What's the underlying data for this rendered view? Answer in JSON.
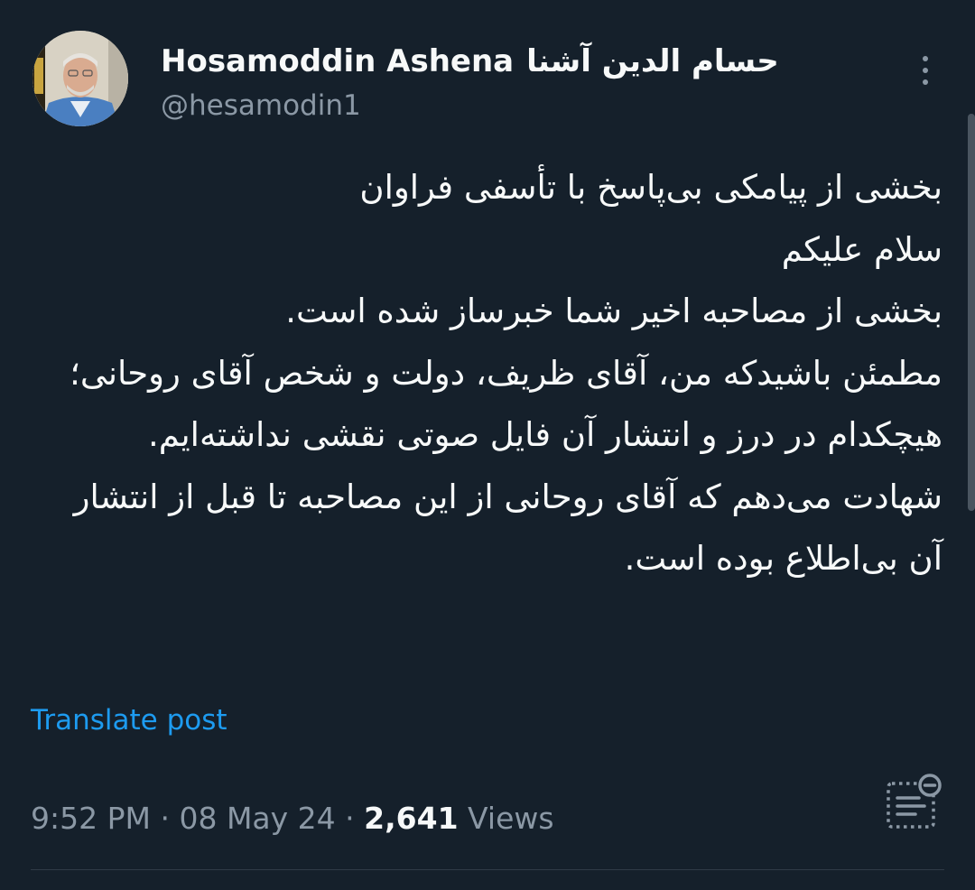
{
  "post": {
    "author": {
      "name_latin": "Hosamoddin Ashena",
      "name_persian": "حسام الدین آشنا",
      "handle": "@hesamodin1"
    },
    "body_lines": [
      "بخشی از پیامکی بی‌پاسخ با تأسفی فراوان",
      "سلام علیکم",
      "بخشی از مصاحبه اخیر شما خبرساز شده است.",
      "مطمئن باشیدکه  من، آقای ظریف، دولت و شخص آقای روحانی؛ هیچکدام در درز و انتشار آن فایل صوتی نقشی نداشته‌ایم.",
      "شهادت می‌دهم که آقای روحانی از این مصاحبه تا قبل از انتشار آن بی‌اطلاع بوده است."
    ],
    "translate_label": "Translate post",
    "time": "9:52 PM",
    "date": "08 May 24",
    "separator": "·",
    "views_count": "2,641",
    "views_label": "Views"
  },
  "icons": {
    "more": "more-vertical-icon",
    "analytics": "view-analytics-icon"
  },
  "colors": {
    "background": "#15202b",
    "text_primary": "#f7f9f9",
    "text_secondary": "#8b98a5",
    "link": "#1d9bf0",
    "divider": "#2f3b47"
  }
}
